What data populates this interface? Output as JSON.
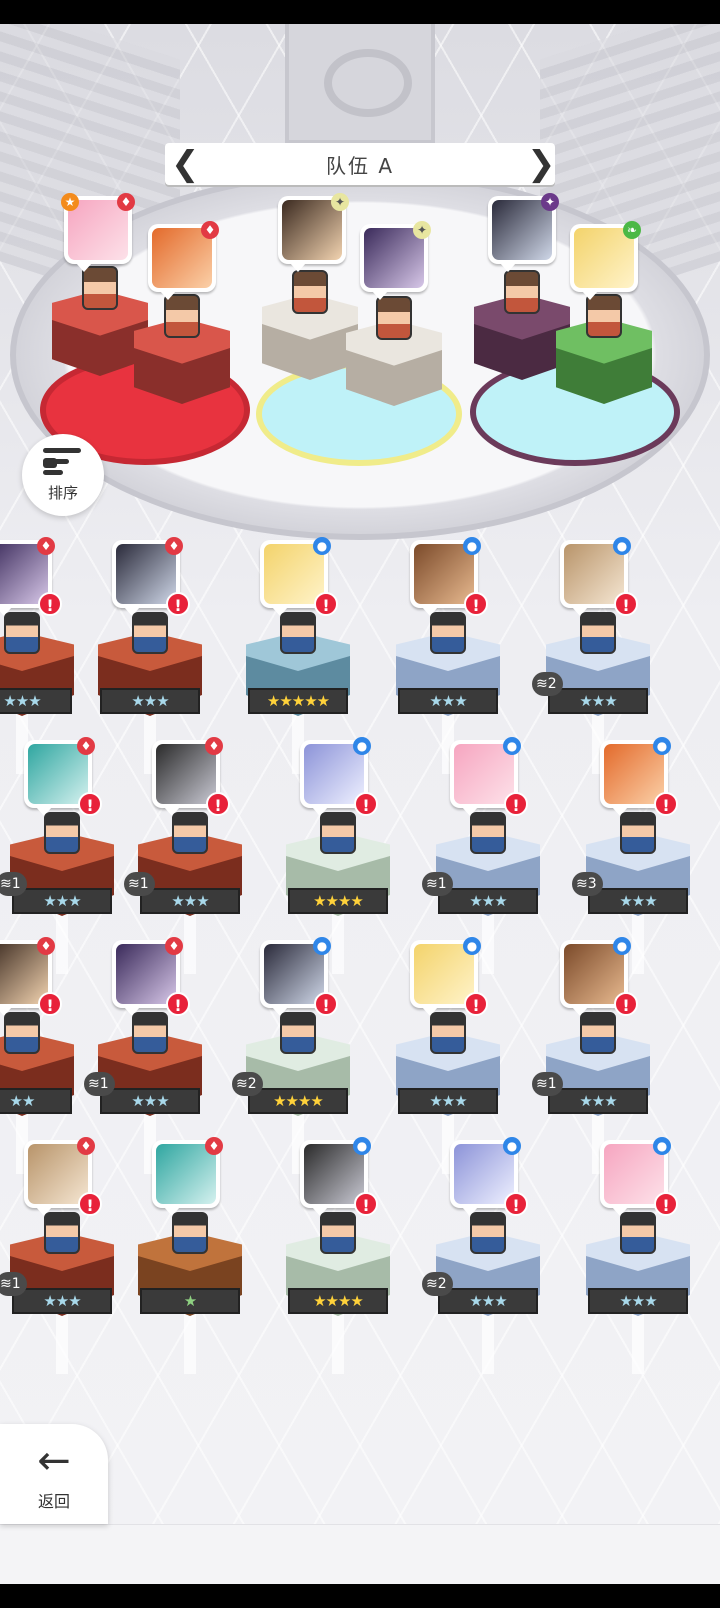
{
  "team": {
    "title": "队伍 A",
    "prev_icon": "left-bracket-arrow",
    "next_icon": "right-bracket-arrow"
  },
  "sort_button": {
    "label": "排序",
    "icon": "sort-descending-icon"
  },
  "back_button": {
    "label": "返回",
    "icon": "arrow-left-icon"
  },
  "colors": {
    "fire": "#e23a44",
    "water": "#2f86e8",
    "light": "#e8e6a0",
    "dark": "#6b3a8a",
    "wind": "#4cb845",
    "alert": "#e8223a",
    "gold_star": "#ffd23a"
  },
  "team_slots": [
    {
      "element": "fire",
      "elite_star": true
    },
    {
      "element": "fire"
    },
    {
      "element": "light"
    },
    {
      "element": "light"
    },
    {
      "element": "dark"
    },
    {
      "element": "wind"
    }
  ],
  "roster": [
    {
      "stars": "★★★",
      "element": "fire",
      "alert": "!"
    },
    {
      "stars": "★★★",
      "element": "fire",
      "alert": "!"
    },
    {
      "stars": "★★★★★",
      "element": "water",
      "alert": "!",
      "gold": true
    },
    {
      "stars": "★★★",
      "element": "water",
      "alert": "!"
    },
    {
      "stars": "★★★",
      "element": "water",
      "alert": "!",
      "stack": "2"
    },
    {
      "stars": "★★★",
      "element": "fire",
      "alert": "!",
      "stack": "1"
    },
    {
      "stars": "★★★",
      "element": "fire",
      "alert": "!",
      "stack": "1"
    },
    {
      "stars": "★★★★",
      "element": "water",
      "alert": "!",
      "gold": true
    },
    {
      "stars": "★★★",
      "element": "water",
      "alert": "!",
      "stack": "1"
    },
    {
      "stars": "★★★",
      "element": "water",
      "alert": "!",
      "stack": "3"
    },
    {
      "stars": "★★",
      "element": "fire",
      "alert": "!"
    },
    {
      "stars": "★★★",
      "element": "fire",
      "alert": "!",
      "stack": "1"
    },
    {
      "stars": "★★★★",
      "element": "water",
      "alert": "!",
      "stack": "2",
      "gold": true
    },
    {
      "stars": "★★★",
      "element": "water",
      "alert": "!"
    },
    {
      "stars": "★★★",
      "element": "water",
      "alert": "!",
      "stack": "1"
    },
    {
      "stars": "★★★",
      "element": "fire",
      "alert": "!",
      "stack": "1"
    },
    {
      "stars": "★",
      "element": "fire"
    },
    {
      "stars": "★★★★",
      "element": "water",
      "alert": "!",
      "gold": true
    },
    {
      "stars": "★★★",
      "element": "water",
      "alert": "!",
      "stack": "2"
    },
    {
      "stars": "★★★",
      "element": "water",
      "alert": "!"
    }
  ]
}
